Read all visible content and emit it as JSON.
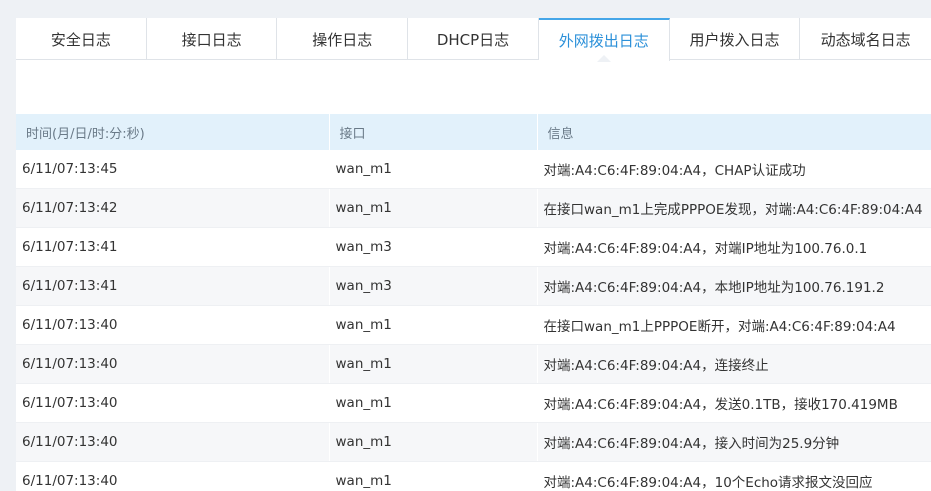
{
  "tabs": [
    {
      "label": "安全日志",
      "active": false
    },
    {
      "label": "接口日志",
      "active": false
    },
    {
      "label": "操作日志",
      "active": false
    },
    {
      "label": "DHCP日志",
      "active": false
    },
    {
      "label": "外网拨出日志",
      "active": true
    },
    {
      "label": "用户拨入日志",
      "active": false
    },
    {
      "label": "动态域名日志",
      "active": false
    }
  ],
  "table": {
    "columns": [
      "时间(月/日/时:分:秒)",
      "接口",
      "信息"
    ],
    "rows": [
      {
        "time": "6/11/07:13:45",
        "iface": "wan_m1",
        "info": "对端:A4:C6:4F:89:04:A4，CHAP认证成功"
      },
      {
        "time": "6/11/07:13:42",
        "iface": "wan_m1",
        "info": "在接口wan_m1上完成PPPOE发现，对端:A4:C6:4F:89:04:A4"
      },
      {
        "time": "6/11/07:13:41",
        "iface": "wan_m3",
        "info": "对端:A4:C6:4F:89:04:A4，对端IP地址为100.76.0.1"
      },
      {
        "time": "6/11/07:13:41",
        "iface": "wan_m3",
        "info": "对端:A4:C6:4F:89:04:A4，本地IP地址为100.76.191.2"
      },
      {
        "time": "6/11/07:13:40",
        "iface": "wan_m1",
        "info": "在接口wan_m1上PPPOE断开，对端:A4:C6:4F:89:04:A4"
      },
      {
        "time": "6/11/07:13:40",
        "iface": "wan_m1",
        "info": "对端:A4:C6:4F:89:04:A4，连接终止"
      },
      {
        "time": "6/11/07:13:40",
        "iface": "wan_m1",
        "info": "对端:A4:C6:4F:89:04:A4，发送0.1TB，接收170.419MB"
      },
      {
        "time": "6/11/07:13:40",
        "iface": "wan_m1",
        "info": "对端:A4:C6:4F:89:04:A4，接入时间为25.9分钟"
      },
      {
        "time": "6/11/07:13:40",
        "iface": "wan_m1",
        "info": "对端:A4:C6:4F:89:04:A4，10个Echo请求报文没回应"
      }
    ]
  },
  "colors": {
    "accent": "#2b90d9",
    "header_bg": "#e2f1fb",
    "page_bg": "#eef1f5"
  }
}
